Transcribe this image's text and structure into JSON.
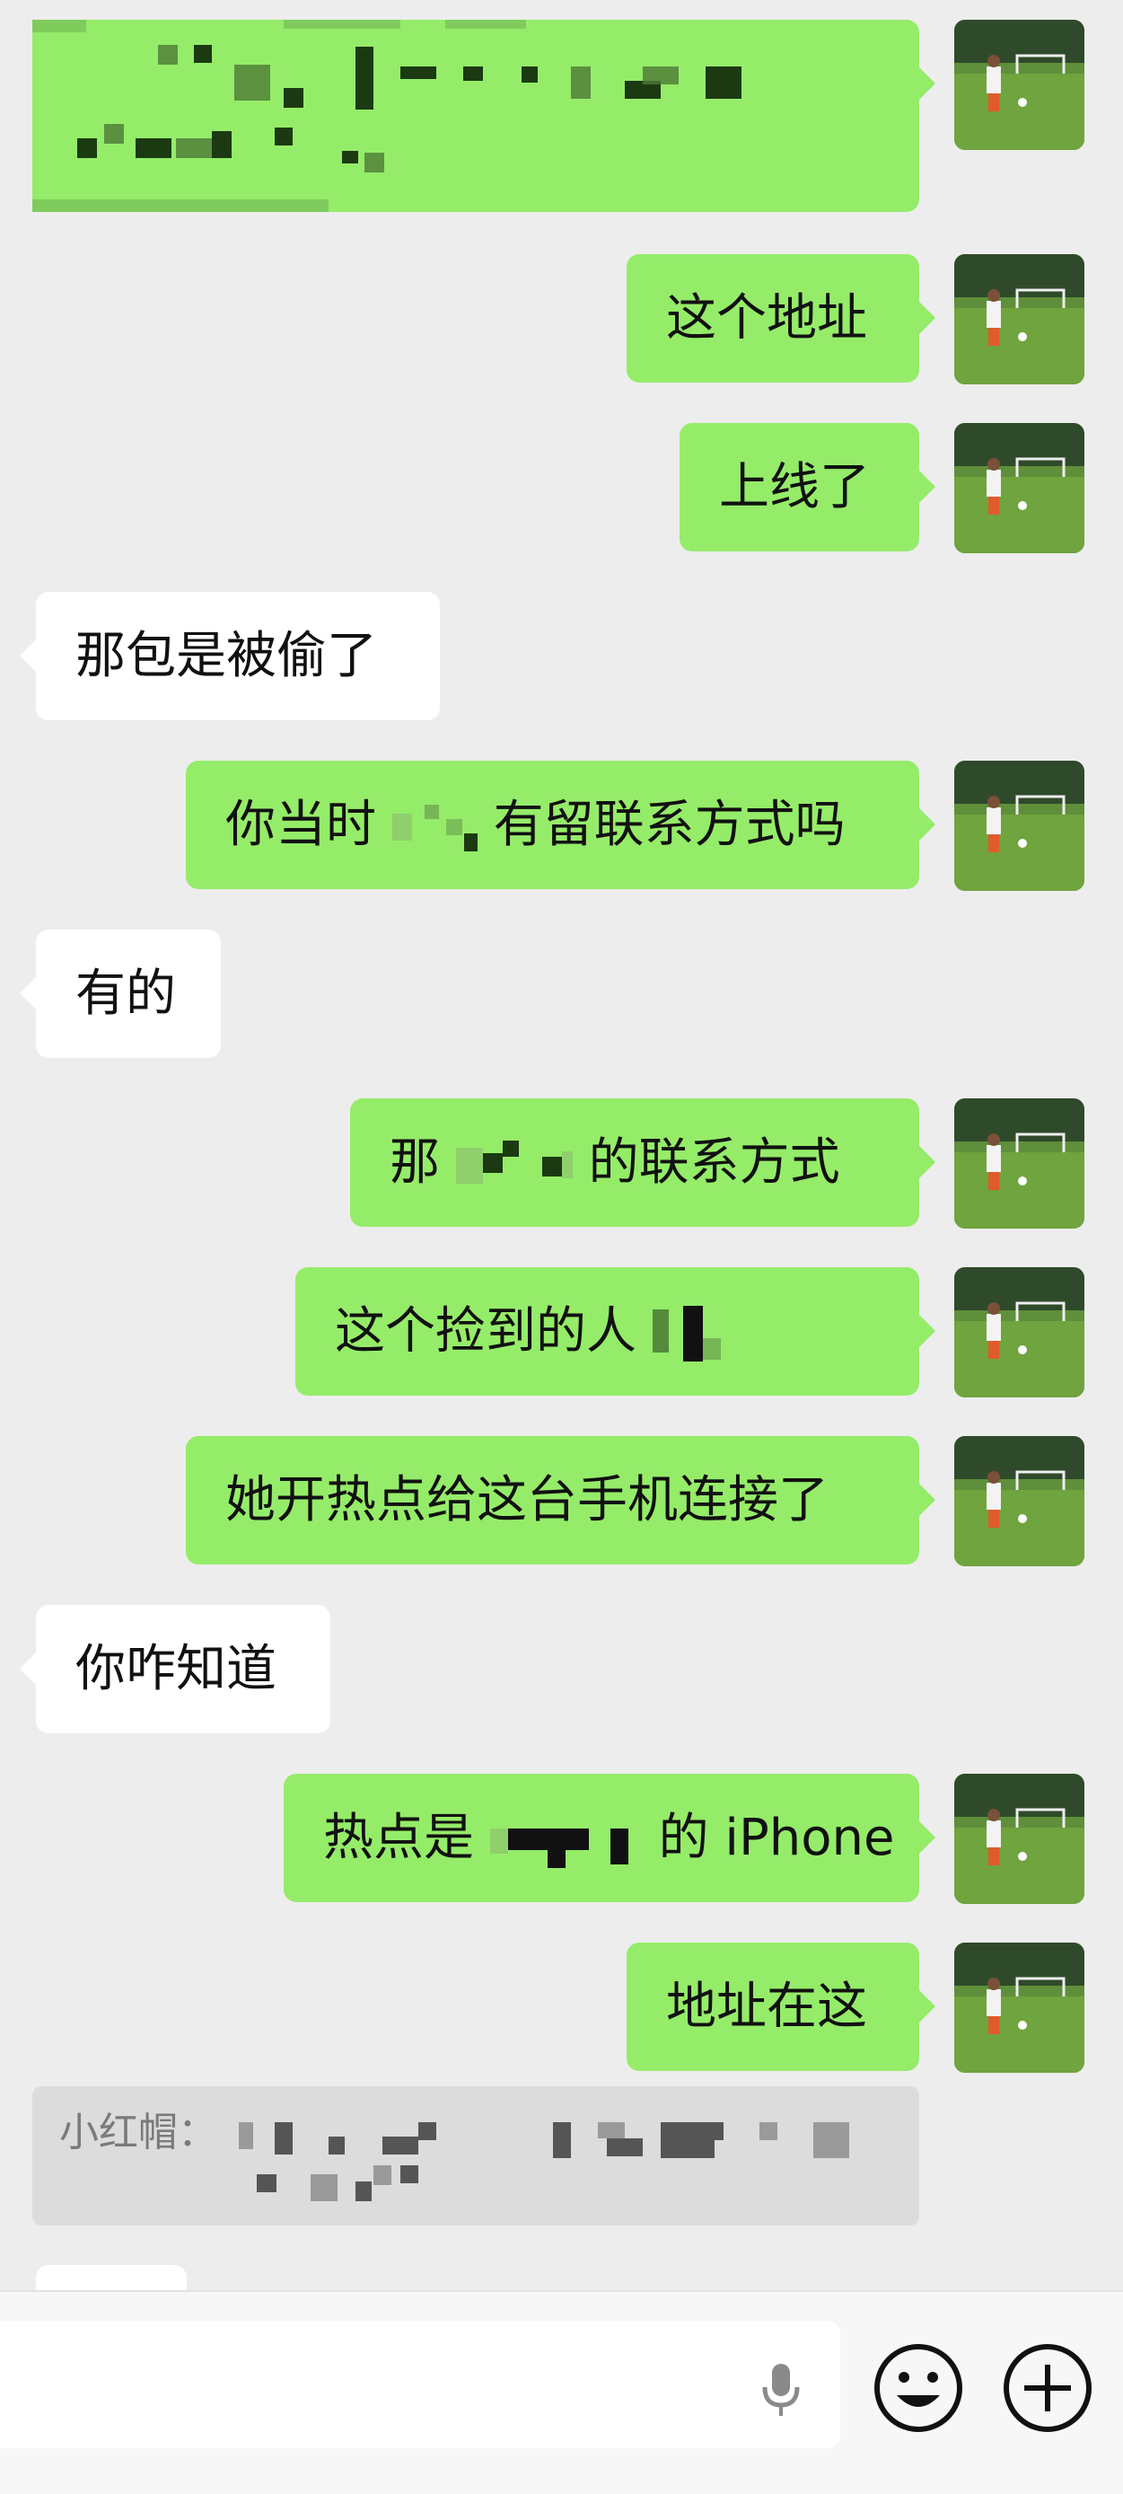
{
  "conversation": [
    {
      "side": "out",
      "text": ""
    },
    {
      "side": "out",
      "text": "这个地址"
    },
    {
      "side": "out",
      "text": "上线了"
    },
    {
      "side": "in",
      "text": "那包是被偷了"
    },
    {
      "side": "out",
      "text_a": "你当时",
      "text_b": "有留联系方式吗"
    },
    {
      "side": "in",
      "text": "有的"
    },
    {
      "side": "out",
      "text_a": "那",
      "text_b": "的联系方式"
    },
    {
      "side": "out",
      "text_a": "这个捡到的人",
      "text_b": ""
    },
    {
      "side": "out",
      "text": "她开热点给这台手机连接了"
    },
    {
      "side": "in",
      "text": "你咋知道"
    },
    {
      "side": "out",
      "text_a": "热点是",
      "text_b": "的 iPhone"
    },
    {
      "side": "out",
      "text": "地址在这"
    }
  ],
  "quoted_message": {
    "sender_prefix": "小红帽："
  },
  "colors": {
    "background": "#ededed",
    "outgoing_bubble": "#95ec69",
    "incoming_bubble": "#ffffff",
    "quote_bg": "#dcdcdc"
  },
  "input_bar": {
    "icons": [
      "microphone-icon",
      "emoji-icon",
      "plus-icon"
    ]
  }
}
